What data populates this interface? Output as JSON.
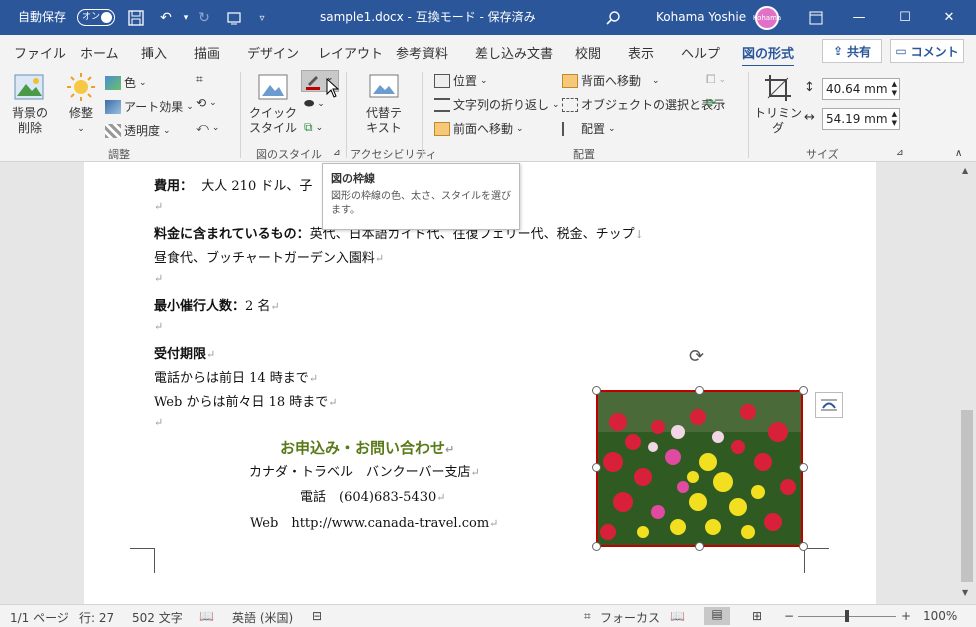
{
  "titlebar": {
    "autosave_label": "自動保存",
    "autosave_state": "オン",
    "doc_title": "sample1.docx - 互換モード - 保存済み",
    "user_name": "Kohama Yoshie",
    "avatar_text": "Kohama"
  },
  "tabs": [
    {
      "label": "ファイル"
    },
    {
      "label": "ホーム"
    },
    {
      "label": "挿入"
    },
    {
      "label": "描画"
    },
    {
      "label": "デザイン"
    },
    {
      "label": "レイアウト"
    },
    {
      "label": "参考資料"
    },
    {
      "label": "差し込み文書"
    },
    {
      "label": "校閲"
    },
    {
      "label": "表示"
    },
    {
      "label": "ヘルプ"
    },
    {
      "label": "図の形式"
    }
  ],
  "share_label": "共有",
  "comment_label": "コメント",
  "ribbon": {
    "remove_bg": "背景の\n削除",
    "corrections": "修整",
    "color": "色",
    "artistic": "アート効果",
    "transparency": "透明度",
    "group_adjust": "調整",
    "quick_styles": "クイック\nスタイル",
    "group_styles": "図のスタイル",
    "alt_text": "代替テ\nキスト",
    "group_access": "アクセシビリティ",
    "position": "位置",
    "wrap_text": "文字列の折り返し",
    "bring_forward": "前面へ移動",
    "send_backward": "背面へ移動",
    "selection_pane": "オブジェクトの選択と表示",
    "align": "配置",
    "group_arrange": "配置",
    "crop": "トリミング",
    "height": "40.64 mm",
    "width": "54.19 mm",
    "group_size": "サイズ"
  },
  "tooltip": {
    "title": "図の枠線",
    "desc": "図形の枠線の色、太さ、スタイルを選びます。"
  },
  "doc": {
    "cost_label": "費用：",
    "cost_value": "大人 210 ドル、子",
    "included_label": "料金に含まれているもの：",
    "included_value": "英代、日本語ガイド代、往復フェリー代、税金、チップ",
    "included_value2": "昼食代、ブッチャートガーデン入園料",
    "min_label": "最小催行人数：",
    "min_value": "2 名",
    "deadline_label": "受付期限",
    "deadline_phone": "電話からは前日 14 時まで",
    "deadline_web": "Web からは前々日 18 時まで",
    "contact_heading": "お申込み・お問い合わせ",
    "contact_branch": "カナダ・トラベル　バンクーバー支店",
    "contact_phone": "電話　(604)683-5430",
    "contact_web": "Web　http://www.canada-travel.com"
  },
  "status": {
    "page": "1/1 ページ",
    "line": "行: 27",
    "words": "502 文字",
    "lang": "英語 (米国)",
    "focus": "フォーカス",
    "zoom": "100%"
  },
  "colors": {
    "titlebar": "#2b579a",
    "picture_border": "#c00000",
    "contact_heading": "#5a7a1a"
  }
}
